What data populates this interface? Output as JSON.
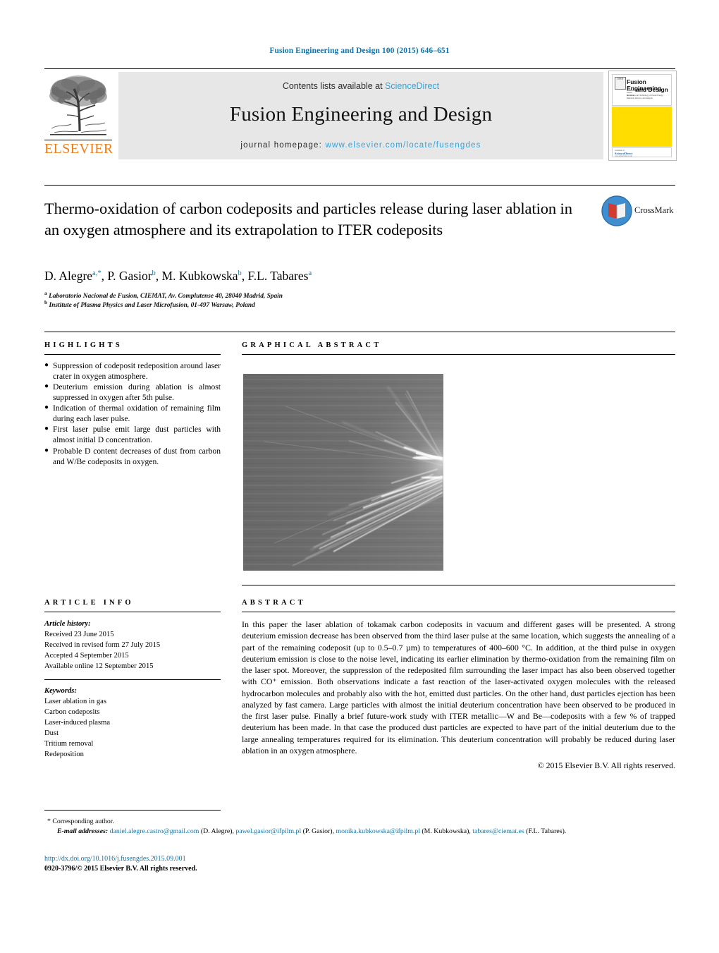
{
  "running_head": "Fusion Engineering and Design 100 (2015) 646–651",
  "masthead": {
    "publisher_name": "ELSEVIER",
    "contents_prefix": "Contents lists available at ",
    "sciencedirect": "ScienceDirect",
    "journal_title": "Fusion Engineering and Design",
    "homepage_label": "journal homepage: ",
    "homepage_url": "www.elsevier.com/locate/fusengdes",
    "cover": {
      "title_line1": "Fusion Engineering",
      "title_line2": "and Design",
      "badge_text": "ISSN",
      "sub_left": "An International Journal devoted to",
      "sub_right": "the Science and Technology of Fusion Energy, Materials, Devices, and Analysis",
      "footer_available": "available at",
      "footer_brand": "ScienceDirect",
      "footer_url": "www.sciencedirect.com"
    }
  },
  "article": {
    "title": "Thermo-oxidation of carbon codeposits and particles release during laser ablation in an oxygen atmosphere and its extrapolation to ITER codeposits",
    "crossmark_label": "CrossMark",
    "authors": [
      {
        "name": "D. Alegre",
        "marks": "a,*"
      },
      {
        "name": "P. Gasior",
        "marks": "b"
      },
      {
        "name": "M. Kubkowska",
        "marks": "b"
      },
      {
        "name": "F.L. Tabares",
        "marks": "a"
      }
    ],
    "affiliations": [
      {
        "mark": "a",
        "text": "Laboratorio Nacional de Fusion, CIEMAT, Av. Complutense 40, 28040 Madrid, Spain"
      },
      {
        "mark": "b",
        "text": "Institute of Plasma Physics and Laser Microfusion, 01-497 Warsaw, Poland"
      }
    ]
  },
  "highlights": {
    "heading": "HIGHLIGHTS",
    "items": [
      "Suppression of codeposit redeposition around laser crater in oxygen atmosphere.",
      "Deuterium emission during ablation is almost suppressed in oxygen after 5th pulse.",
      "Indication of thermal oxidation of remaining film during each laser pulse.",
      "First laser pulse emit large dust particles with almost initial D concentration.",
      "Probable D content decreases of dust from carbon and W/Be codeposits in oxygen."
    ]
  },
  "graphical_abstract": {
    "heading": "GRAPHICAL ABSTRACT",
    "image_description": "Grayscale fast-camera frame showing bright dust particle tracks radiating from the laser impact point at the right edge"
  },
  "article_info": {
    "heading": "ARTICLE INFO",
    "history_label": "Article history:",
    "history": [
      "Received 23 June 2015",
      "Received in revised form 27 July 2015",
      "Accepted 4 September 2015",
      "Available online 12 September 2015"
    ],
    "keywords_label": "Keywords:",
    "keywords": [
      "Laser ablation in gas",
      "Carbon codeposits",
      "Laser-induced plasma",
      "Dust",
      "Tritium removal",
      "Redeposition"
    ]
  },
  "abstract": {
    "heading": "ABSTRACT",
    "text": "In this paper the laser ablation of tokamak carbon codeposits in vacuum and different gases will be presented. A strong deuterium emission decrease has been observed from the third laser pulse at the same location, which suggests the annealing of a part of the remaining codeposit (up to 0.5–0.7 µm) to temperatures of 400–600 °C. In addition, at the third pulse in oxygen deuterium emission is close to the noise level, indicating its earlier elimination by thermo-oxidation from the remaining film on the laser spot. Moreover, the suppression of the redeposited film surrounding the laser impact has also been observed together with CO⁺ emission. Both observations indicate a fast reaction of the laser-activated oxygen molecules with the released hydrocarbon molecules and probably also with the hot, emitted dust particles. On the other hand, dust particles ejection has been analyzed by fast camera. Large particles with almost the initial deuterium concentration have been observed to be produced in the first laser pulse. Finally a brief future-work study with ITER metallic—W and Be—codeposits with a few % of trapped deuterium has been made. In that case the produced dust particles are expected to have part of the initial deuterium due to the large annealing temperatures required for its elimination. This deuterium concentration will probably be reduced during laser ablation in an oxygen atmosphere.",
    "copyright": "© 2015 Elsevier B.V. All rights reserved."
  },
  "footer": {
    "corresponding_author": "* Corresponding author.",
    "emails_label": "E-mail addresses:",
    "emails": [
      {
        "address": "daniel.alegre.castro@gmail.com",
        "person": "(D. Alegre),"
      },
      {
        "address": "pawel.gasior@ifpilm.pl",
        "person": "(P. Gasior),"
      },
      {
        "address": "monika.kubkowska@ifpilm.pl",
        "person": "(M. Kubkowska),"
      },
      {
        "address": "tabares@ciemat.es",
        "person": "(F.L. Tabares)."
      }
    ],
    "doi": "http://dx.doi.org/10.1016/j.fusengdes.2015.09.001",
    "issn_line": "0920-3796/© 2015 Elsevier B.V. All rights reserved."
  },
  "colors": {
    "link_blue": "#1273a8",
    "sciencedirect_blue": "#2fa3dd",
    "elsevier_orange": "#ef7d1a",
    "cover_yellow": "#ffdd00"
  }
}
